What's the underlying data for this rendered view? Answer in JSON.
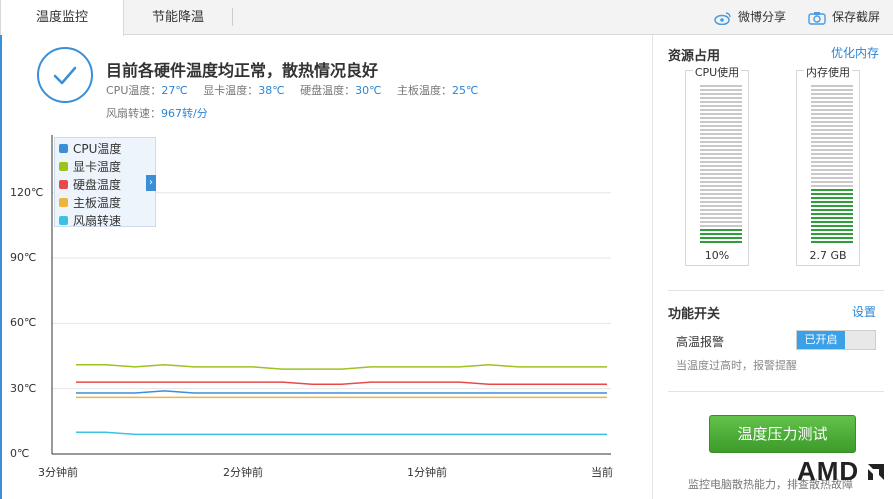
{
  "tabs": [
    {
      "label": "温度监控",
      "active": true
    },
    {
      "label": "节能降温",
      "active": false
    }
  ],
  "toolbar": {
    "weibo_share": "微博分享",
    "save_screenshot": "保存截屏"
  },
  "status": {
    "title": "目前各硬件温度均正常，散热情况良好",
    "cpu_label": "CPU温度：",
    "cpu_value": "27℃",
    "gpu_label": "显卡温度：",
    "gpu_value": "38℃",
    "disk_label": "硬盘温度：",
    "disk_value": "30℃",
    "board_label": "主板温度：",
    "board_value": "25℃",
    "fan_label": "风扇转速：",
    "fan_value": "967转/分"
  },
  "chart_data": {
    "type": "line",
    "title": "",
    "xlabel": "",
    "ylabel": "",
    "y_ticks": [
      "0℃",
      "30℃",
      "60℃",
      "90℃",
      "120℃"
    ],
    "x_ticks": [
      "3分钟前",
      "2分钟前",
      "1分钟前",
      "当前"
    ],
    "ylim": [
      0,
      130
    ],
    "legend_position": "top-left",
    "grid": true,
    "x": [
      0,
      10,
      20,
      30,
      40,
      50,
      60,
      70,
      80,
      90,
      100,
      110,
      120,
      130,
      140,
      150,
      160,
      170,
      180
    ],
    "series": [
      {
        "name": "CPU温度",
        "color": "#3a8fd6",
        "values": [
          28,
          28,
          28,
          29,
          28,
          28,
          28,
          28,
          28,
          28,
          28,
          28,
          28,
          28,
          28,
          28,
          28,
          28,
          28
        ]
      },
      {
        "name": "显卡温度",
        "color": "#9ec21e",
        "values": [
          41,
          41,
          40,
          41,
          40,
          40,
          40,
          39,
          39,
          39,
          40,
          40,
          40,
          40,
          41,
          40,
          40,
          40,
          40
        ]
      },
      {
        "name": "硬盘温度",
        "color": "#e84a4a",
        "values": [
          33,
          33,
          33,
          33,
          33,
          33,
          33,
          33,
          32,
          32,
          33,
          33,
          33,
          33,
          32,
          32,
          32,
          32,
          32
        ]
      },
      {
        "name": "主板温度",
        "color": "#f0b43c",
        "values": [
          26,
          26,
          26,
          26,
          26,
          26,
          26,
          26,
          26,
          26,
          26,
          26,
          26,
          26,
          26,
          26,
          26,
          26,
          26
        ]
      },
      {
        "name": "风扇转速",
        "color": "#3cc0e4",
        "values": [
          10,
          10,
          9,
          9,
          9,
          9,
          9,
          9,
          9,
          9,
          9,
          9,
          9,
          9,
          9,
          9,
          9,
          9,
          9
        ]
      }
    ]
  },
  "resources": {
    "title": "资源占用",
    "optimize_link": "优化内存",
    "cpu_label": "CPU使用",
    "cpu_value": "10%",
    "cpu_fraction": 0.1,
    "mem_label": "内存使用",
    "mem_value": "2.7 GB",
    "mem_fraction": 0.34
  },
  "features": {
    "title": "功能开关",
    "settings_link": "设置",
    "alarm_label": "高温报警",
    "alarm_state": "已开启",
    "alarm_hint": "当温度过高时，报警提醒"
  },
  "stress_button": "温度压力测试",
  "footer": {
    "text": "监控电脑散热能力，排查散热故障",
    "brand": "AMD"
  },
  "colors": {
    "accent": "#3a8fd6",
    "meter_green": "#2e9e3a",
    "meter_gray": "#c8c8c8",
    "button_green": "#4aae34"
  }
}
